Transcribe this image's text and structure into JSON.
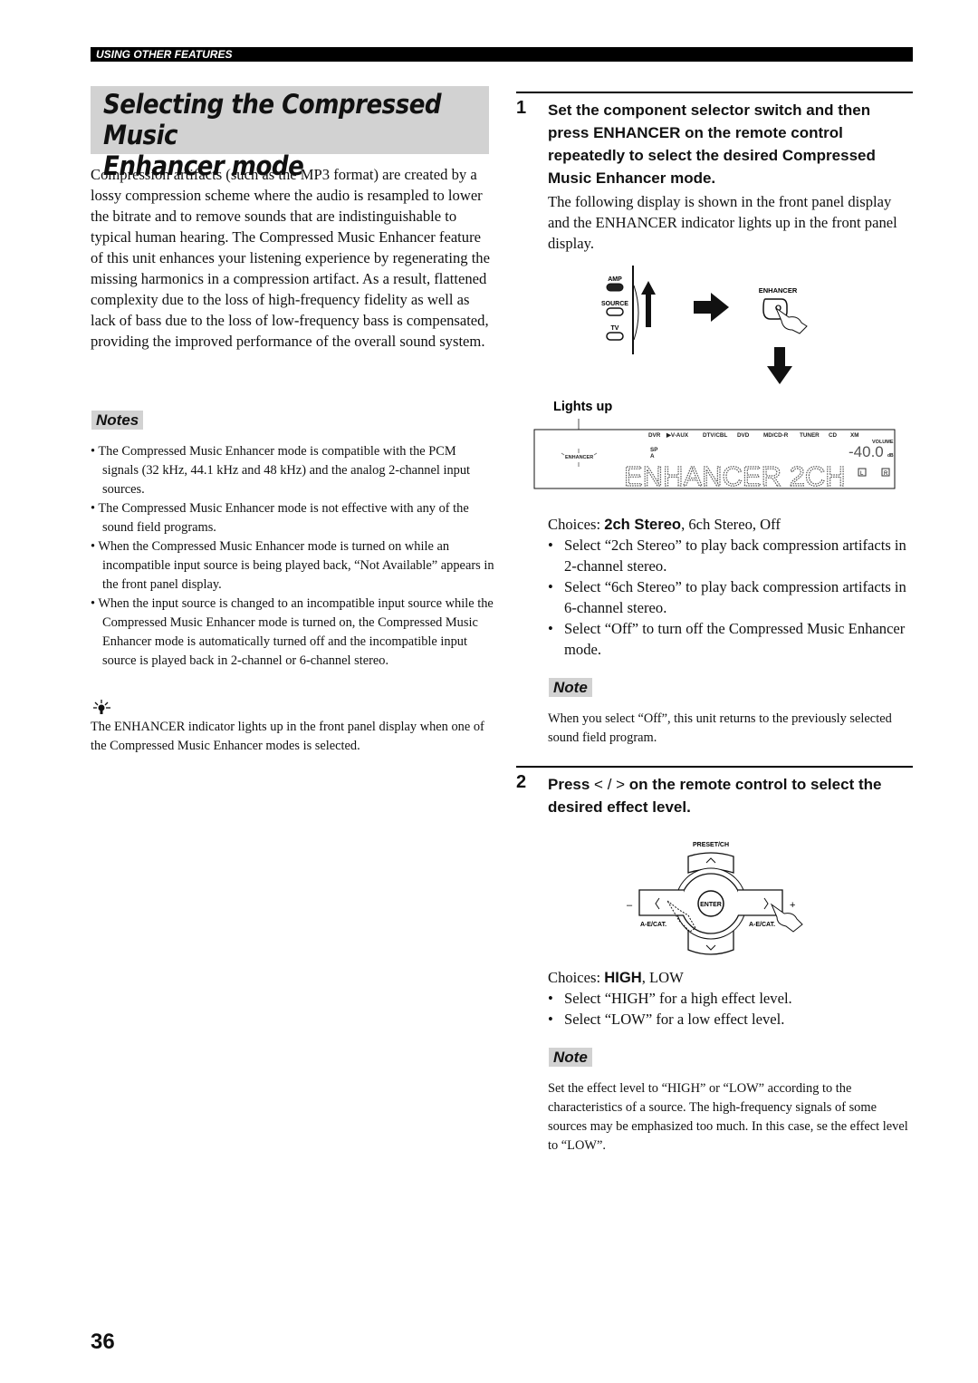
{
  "header": {
    "section": "USING OTHER FEATURES"
  },
  "title": {
    "line1": "Selecting the Compressed Music",
    "line2": "Enhancer mode"
  },
  "intro": "Compression artifacts (such as the MP3 format) are created by a lossy compression scheme where the audio is resampled to lower the bitrate and to remove sounds that are indistinguishable to typical human hearing. The Compressed Music Enhancer feature of this unit enhances your listening experience by regenerating the missing harmonics in a compression artifact. As a result, flattened complexity due to the loss of high-frequency fidelity as well as lack of bass due to the loss of low-frequency bass is compensated, providing the improved performance of the overall sound system.",
  "notes": {
    "label": "Notes",
    "items": [
      "The Compressed Music Enhancer mode is compatible with the PCM signals (32 kHz, 44.1 kHz and 48 kHz) and the analog 2-channel input sources.",
      "The Compressed Music Enhancer mode is not effective with any of the sound field programs.",
      "When the Compressed Music Enhancer mode is turned on while an incompatible input source is being played back, “Not Available” appears in the front panel display.",
      "When the input source is changed to an incompatible input source while the Compressed Music Enhancer mode is turned on, the Compressed Music Enhancer mode is automatically turned off and the incompatible input source is played back in 2-channel or 6-channel stereo."
    ]
  },
  "tip": {
    "icon": "lightbulb-icon",
    "text": "The ENHANCER indicator lights up in the front panel display when one of the Compressed Music Enhancer modes is selected."
  },
  "step1": {
    "number": "1",
    "heading": "Set the component selector switch and then press ENHANCER on the remote control repeatedly to select the desired Compressed Music Enhancer mode.",
    "text": "The following display is shown in the front panel display and the ENHANCER indicator lights up in the front panel display.",
    "figure": {
      "amp": "AMP",
      "source": "SOURCE",
      "tv": "TV",
      "enhancer_button": "ENHANCER",
      "lights_up": "Lights up",
      "display": {
        "inputs": [
          "DVR",
          "▶V-AUX",
          "DTV/CBL",
          "DVD",
          "MD/CD-R",
          "TUNER",
          "CD",
          "XM"
        ],
        "indicator": "ENHANCER",
        "sp": "SP",
        "sp_a": "A",
        "volume_label": "VOLUME",
        "volume": "-40.0",
        "db": "dB",
        "main": "ENHANCER 2CH",
        "l": "L",
        "r": "R"
      }
    },
    "choices_label": "Choices: ",
    "choices_default": "2ch Stereo",
    "choices_rest": ", 6ch Stereo, Off",
    "bullets": [
      "Select “2ch Stereo” to play back compression artifacts in 2-channel stereo.",
      "Select “6ch Stereo” to play back compression artifacts in 6-channel stereo.",
      "Select “Off” to turn off the Compressed Music Enhancer mode."
    ],
    "note_label": "Note",
    "note": "When you select “Off”, this unit returns to the previously selected sound field program."
  },
  "step2": {
    "number": "2",
    "heading_a": "Press ",
    "heading_keys": "< / >",
    "heading_b": " on the remote control to select the desired effect level.",
    "figure": {
      "preset": "PRESET/CH",
      "enter": "ENTER",
      "minus": "–",
      "plus": "+",
      "aecat_left": "A-E/CAT.",
      "aecat_right": "A-E/CAT."
    },
    "choices_label": "Choices: ",
    "choices_default": "HIGH",
    "choices_rest": ", LOW",
    "bullets": [
      "Select “HIGH” for a high effect level.",
      "Select “LOW” for a low effect level."
    ],
    "note_label": "Note",
    "note": "Set the effect level to “HIGH” or “LOW” according to the characteristics of a source. The high-frequency signals of some sources may be emphasized too much. In this case, se the effect level to “LOW”."
  },
  "page_number": "36"
}
